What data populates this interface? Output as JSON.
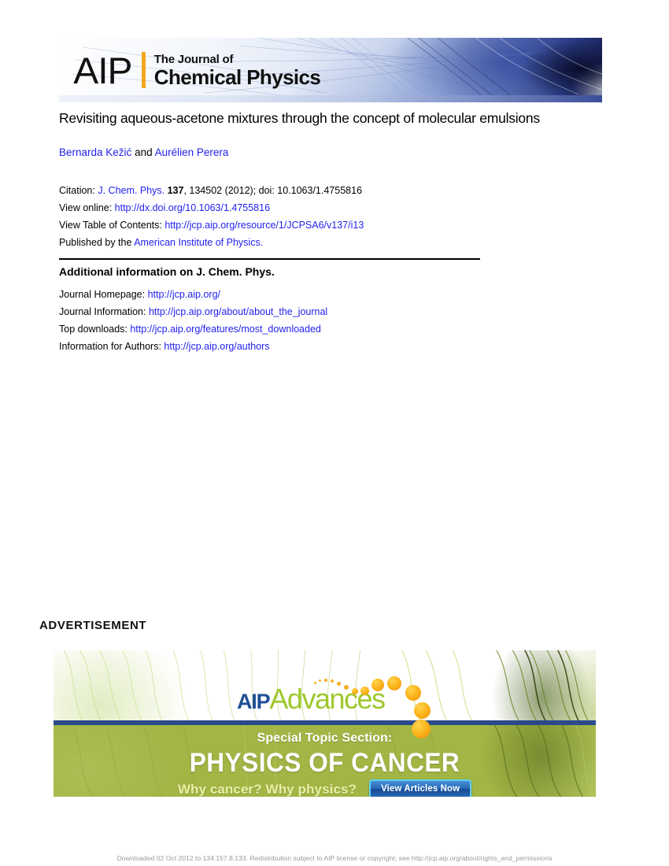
{
  "header_banner": {
    "logo_text": "AIP",
    "journal_prefix": "The Journal of",
    "journal_name": "Chemical Physics",
    "accent_color": "#f0a820"
  },
  "article": {
    "title": "Revisiting aqueous-acetone mixtures through the concept of molecular emulsions",
    "authors_first": "Bernarda Kežić",
    "authors_conjunction": " and ",
    "authors_second": "Aurélien Perera"
  },
  "citation": {
    "label": "Citation: ",
    "journal_link": "J. Chem. Phys.",
    "volume": "137",
    "rest": ", 134502 (2012); doi: 10.1063/1.4755816",
    "view_online_label": "View online: ",
    "view_online_url": "http://dx.doi.org/10.1063/1.4755816",
    "toc_label": "View Table of Contents: ",
    "toc_url": "http://jcp.aip.org/resource/1/JCPSA6/v137/i13",
    "publisher_label": "Published by the ",
    "publisher_link": "American Institute of Physics."
  },
  "additional": {
    "heading": "Additional information on J. Chem. Phys.",
    "rows": [
      {
        "label": "Journal Homepage: ",
        "url": "http://jcp.aip.org/"
      },
      {
        "label": "Journal Information: ",
        "url": "http://jcp.aip.org/about/about_the_journal"
      },
      {
        "label": "Top downloads: ",
        "url": "http://jcp.aip.org/features/most_downloaded"
      },
      {
        "label": "Information for Authors: ",
        "url": "http://jcp.aip.org/authors"
      }
    ]
  },
  "advertisement": {
    "label": "ADVERTISEMENT",
    "logo_aip": "AIP",
    "logo_advances": "Advances",
    "special_topic": "Special Topic Section:",
    "headline": "PHYSICS OF CANCER",
    "tagline": "Why cancer?  Why physics?",
    "button_label": "View Articles Now",
    "green_color": "#a3b545",
    "divider_color": "#2a4a8a",
    "dot_color": "#fbb116"
  },
  "footer": {
    "text": "Downloaded 02 Oct 2012 to 134.157.8.133. Redistribution subject to AIP license or copyright; see http://jcp.aip.org/about/rights_and_permissions"
  }
}
